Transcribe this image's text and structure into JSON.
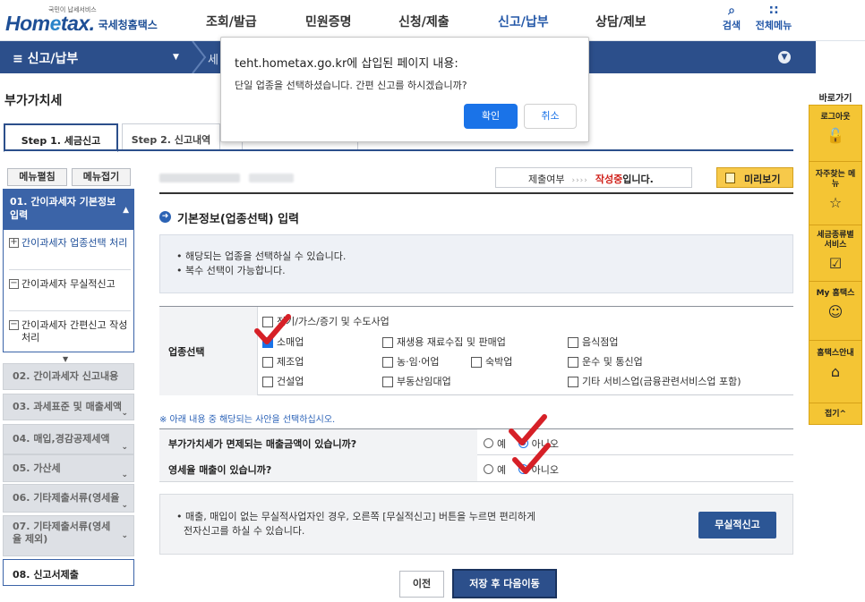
{
  "header": {
    "logo_small": "국민이 납세서비스",
    "logo_brand_1": "Hom",
    "logo_brand_e": "e",
    "logo_brand_2": "tax.",
    "logo_kr": "국세청홈택스",
    "menu": [
      "조회/발급",
      "민원증명",
      "신청/제출",
      "신고/납부",
      "상담/제보"
    ],
    "active_menu": "신고/납부",
    "search_label": "검색",
    "all_menu_label": "전체메뉴"
  },
  "bluebar": {
    "title": "≡  신고/납부",
    "sub": "세"
  },
  "page_title": "부가가치세",
  "tabs": [
    "Step 1. 세금신고",
    "Step 2. 신고내역"
  ],
  "dialog": {
    "title": "teht.hometax.go.kr에 삽입된 페이지 내용:",
    "message": "단일 업종을 선택하셨습니다. 간편 신고를 하시겠습니까?",
    "ok": "확인",
    "cancel": "취소"
  },
  "left_menu": {
    "expand": "메뉴펼침",
    "collapse": "메뉴접기",
    "step01": "01. 간이과세자 기본정보 입력",
    "sub_items": [
      "간이과세자 업종선택 처리",
      "간이과세자 무실적신고",
      "간이과세자 간편신고 작성 처리"
    ],
    "steps": [
      "02. 간이과세자 신고내용",
      "03. 과세표준 및 매출세액",
      "04. 매입,경감공제세액",
      "05. 가산세",
      "06. 기타제출서류(영세율",
      "07. 기타제출서류(영세율 제외)"
    ],
    "step08": "08. 신고서제출"
  },
  "status": {
    "label": "제출여부",
    "arrows": "››››",
    "state": "작성중",
    "state_suffix": "입니다.",
    "preview": "미리보기"
  },
  "section_title": "기본정보(업종선택) 입력",
  "info": [
    "• 해당되는 업종을 선택하실 수 있습니다.",
    "• 복수 선택이 가능합니다."
  ],
  "business": {
    "header": "업종선택",
    "options": [
      {
        "label": "전기/가스/증기 및 수도사업",
        "checked": false
      },
      {
        "label": "소매업",
        "checked": true
      },
      {
        "label": "재생용 재료수집 및 판매업",
        "checked": false
      },
      {
        "label": "음식점업",
        "checked": false
      },
      {
        "label": "제조업",
        "checked": false
      },
      {
        "label": "농·임·어업",
        "checked": false
      },
      {
        "label": "숙박업",
        "checked": false
      },
      {
        "label": "운수 및 통신업",
        "checked": false
      },
      {
        "label": "건설업",
        "checked": false
      },
      {
        "label": "부동산임대업",
        "checked": false
      },
      {
        "label": "기타 서비스업(금융관련서비스업 포함)",
        "checked": false
      }
    ]
  },
  "notice2": "※ 아래 내용 중 해당되는 사안을 선택하십시오.",
  "questions": [
    {
      "q": "부가가치세가 면제되는 매출금액이 있습니까?",
      "yes": "예",
      "no": "아니오",
      "selected": "no"
    },
    {
      "q": "영세율 매출이 있습니까?",
      "yes": "예",
      "no": "아니오",
      "selected": "no"
    }
  ],
  "no_result": {
    "text1": "• 매출, 매입이 없는 무실적사업자인 경우, 오른쪽 [무실적신고] 버튼을 누르면 편리하게",
    "text2": "전자신고를 하실 수 있습니다.",
    "button": "무실적신고"
  },
  "buttons": {
    "prev": "이전",
    "next": "저장 후 다음이동"
  },
  "right_panel": {
    "title": "바로가기",
    "items": [
      "로그아웃",
      "자주찾는 메뉴",
      "세금종류별 서비스",
      "My 홈택스",
      "홈택스안내"
    ],
    "fold": "접기^"
  },
  "colors": {
    "brand": "#1e4f96",
    "bar": "#2c4f8b",
    "accent": "#1a73e8",
    "check": "#d62027",
    "panel": "#f4c534"
  }
}
